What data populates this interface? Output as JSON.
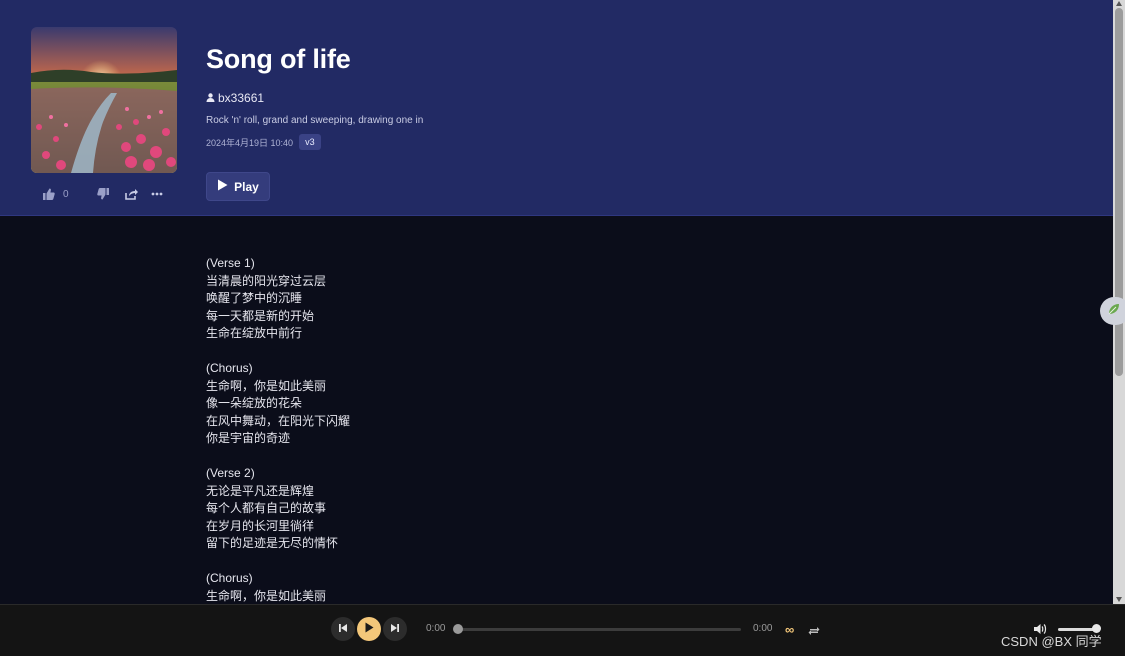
{
  "song": {
    "title": "Song of life",
    "artist": "bx33661",
    "description": "Rock 'n' roll, grand and sweeping, drawing one in",
    "date": "2024年4月19日 10:40",
    "version": "v3",
    "like_count": "0",
    "play_label": "Play"
  },
  "lyrics": [
    "(Verse 1)",
    "当清晨的阳光穿过云层",
    "唤醒了梦中的沉睡",
    "每一天都是新的开始",
    "生命在绽放中前行",
    "",
    "(Chorus)",
    "生命啊，你是如此美丽",
    "像一朵绽放的花朵",
    "在风中舞动，在阳光下闪耀",
    "你是宇宙的奇迹",
    "",
    "(Verse 2)",
    "无论是平凡还是辉煌",
    "每个人都有自己的故事",
    "在岁月的长河里徜徉",
    "留下的足迹是无尽的情怀",
    "",
    "(Chorus)",
    "生命啊，你是如此美丽"
  ],
  "player": {
    "current_time": "0:00",
    "duration": "0:00",
    "loop_symbol": "∞",
    "progress": 0,
    "volume": 0.85
  },
  "watermark": "CSDN @BX 同学",
  "colors": {
    "header_bg": "#222a64",
    "page_bg": "#0b0d1a",
    "accent": "#f3c77a",
    "player_bg": "#141414"
  }
}
